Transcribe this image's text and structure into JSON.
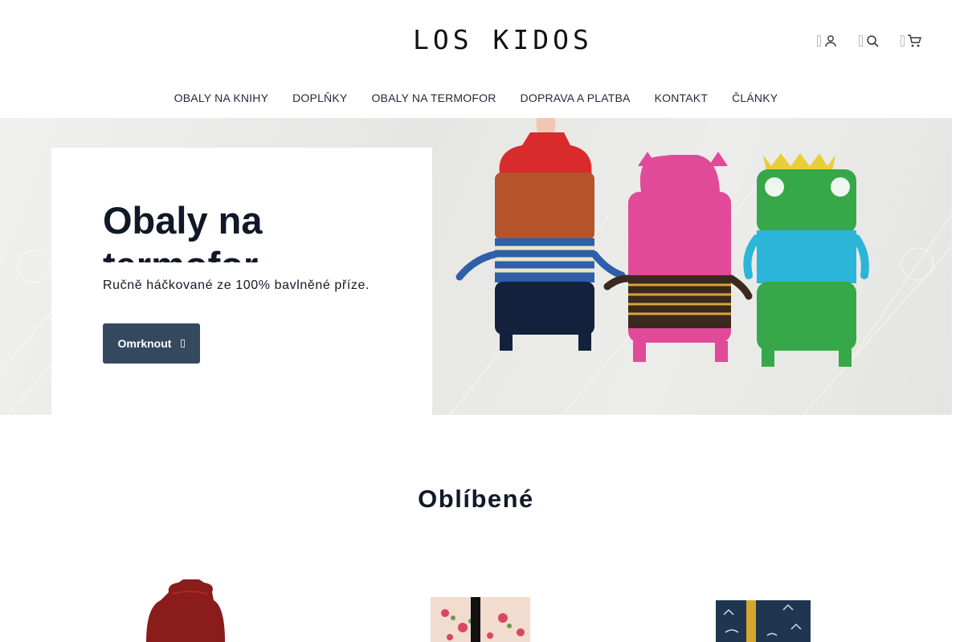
{
  "brand": {
    "logo_text": "LOS KIDOS"
  },
  "header_icons": [
    {
      "name": "user-icon"
    },
    {
      "name": "search-icon"
    },
    {
      "name": "cart-icon"
    }
  ],
  "nav": {
    "items": [
      "OBALY NA KNIHY",
      "DOPLŇKY",
      "OBALY NA TERMOFOR",
      "DOPRAVA A PLATBA",
      "KONTAKT",
      "ČLÁNKY"
    ]
  },
  "hero": {
    "title": "Obaly na termofor",
    "subtitle": "Ručně háčkované ze 100% bavlněné příze.",
    "button_label": "Omrknout",
    "button_color": "#34495e"
  },
  "featured": {
    "title": "Oblíbené",
    "products": [
      {
        "name": "red-hot-water-bottle-cover",
        "color": "#8b1c1c"
      },
      {
        "name": "floral-book-cover",
        "color": "#f1dccf"
      },
      {
        "name": "navy-fox-book-cover",
        "color": "#1f3550"
      }
    ]
  }
}
